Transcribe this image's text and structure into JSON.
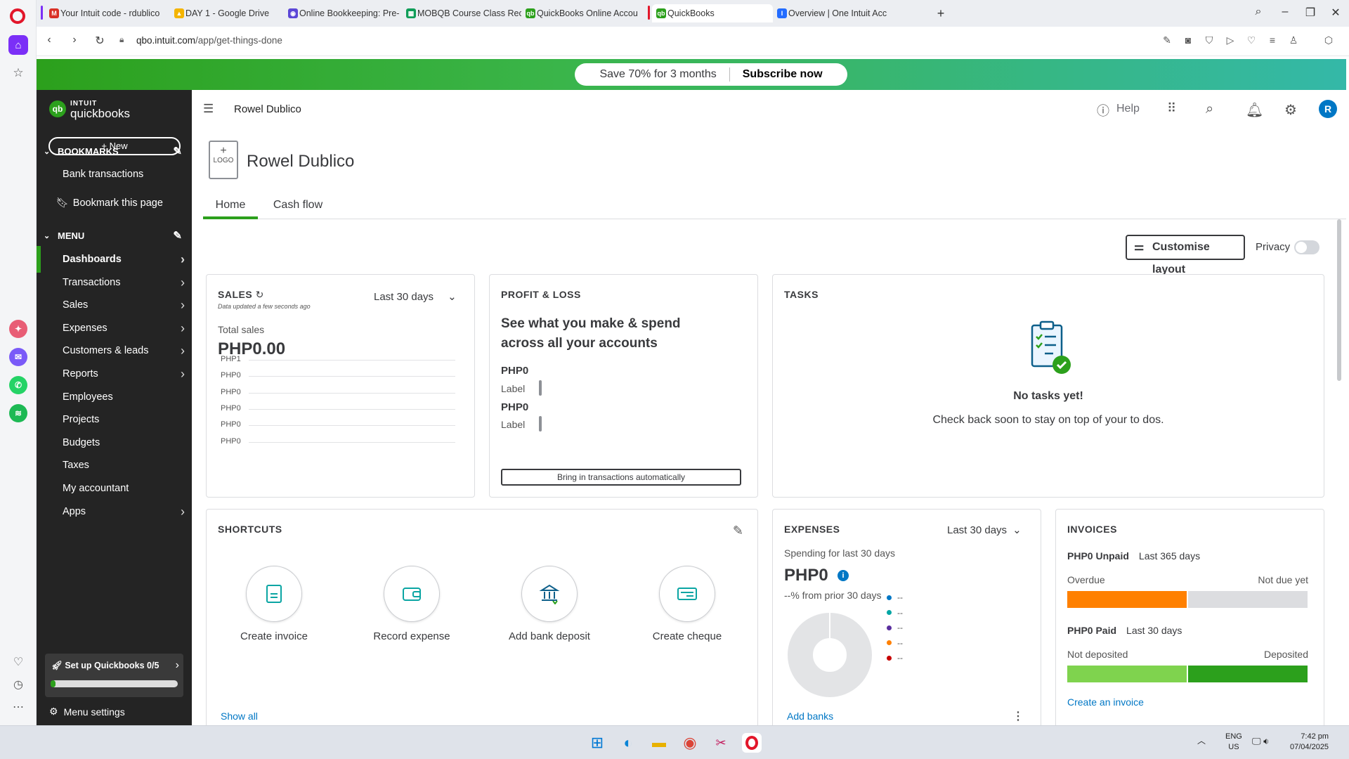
{
  "browser": {
    "tabs": [
      {
        "title": "Your Intuit code - rdublico",
        "fav": "M",
        "color": "#d93025",
        "accent": "#7b2ff7"
      },
      {
        "title": "DAY 1 - Google Drive",
        "fav": "▲",
        "color": "#f4b400",
        "accent": ""
      },
      {
        "title": "Online Bookkeeping: Pre-",
        "fav": "◉",
        "color": "#5b46d6",
        "accent": ""
      },
      {
        "title": "MOBQB Course Class Rec",
        "fav": "▦",
        "color": "#0f9d58",
        "accent": ""
      },
      {
        "title": "QuickBooks Online Accou",
        "fav": "qb",
        "color": "#2ca01c",
        "accent": ""
      },
      {
        "title": "QuickBooks",
        "fav": "qb",
        "color": "#2ca01c",
        "accent": "#e2162a"
      },
      {
        "title": "Overview | One Intuit Acc",
        "fav": "I",
        "color": "#236cff",
        "accent": ""
      }
    ],
    "url_host": "qbo.intuit.com",
    "url_path": "/app/get-things-done"
  },
  "promo": {
    "text": "Save 70% for 3 months",
    "cta": "Subscribe now"
  },
  "nav": {
    "logo_top": "INTUIT",
    "logo_bottom": "quickbooks",
    "new_label": "+ New",
    "bookmarks_header": "BOOKMARKS",
    "bookmarks": [
      "Bank transactions",
      "Bookmark this page"
    ],
    "menu_header": "MENU",
    "items": [
      {
        "label": "Dashboards",
        "arrow": true
      },
      {
        "label": "Transactions",
        "arrow": true
      },
      {
        "label": "Sales",
        "arrow": true
      },
      {
        "label": "Expenses",
        "arrow": true
      },
      {
        "label": "Customers & leads",
        "arrow": true
      },
      {
        "label": "Reports",
        "arrow": true
      },
      {
        "label": "Employees",
        "arrow": false
      },
      {
        "label": "Projects",
        "arrow": false
      },
      {
        "label": "Budgets",
        "arrow": false
      },
      {
        "label": "Taxes",
        "arrow": false
      },
      {
        "label": "My accountant",
        "arrow": false
      },
      {
        "label": "Apps",
        "arrow": true
      }
    ],
    "setup_label": "Set up Quickbooks 0/5",
    "setup_progress": 0.04,
    "menu_settings": "Menu settings"
  },
  "header": {
    "company": "Rowel Dublico",
    "help": "Help",
    "avatar": "R"
  },
  "page": {
    "logo_plus": "+",
    "logo_text": "LOGO",
    "company_name": "Rowel Dublico",
    "tabs": [
      "Home",
      "Cash flow"
    ],
    "customise": "Customise layout",
    "privacy": "Privacy"
  },
  "sales": {
    "title": "SALES",
    "updated": "Data updated a few seconds ago",
    "period": "Last 30 days",
    "total_label": "Total sales",
    "total": "PHP0.00",
    "y_labels": [
      "PHP1",
      "PHP0",
      "PHP0",
      "PHP0",
      "PHP0",
      "PHP0"
    ]
  },
  "profit_loss": {
    "title": "PROFIT & LOSS",
    "headline": "See what you make & spend across all your accounts",
    "rows": [
      {
        "value": "PHP0",
        "label": "Label"
      },
      {
        "value": "PHP0",
        "label": "Label"
      }
    ],
    "button": "Bring in transactions automatically"
  },
  "tasks": {
    "title": "TASKS",
    "empty_title": "No tasks yet!",
    "empty_text": "Check back soon to stay on top of your to dos."
  },
  "shortcuts": {
    "title": "SHORTCUTS",
    "items": [
      "Create invoice",
      "Record expense",
      "Add bank deposit",
      "Create cheque"
    ],
    "show_all": "Show all"
  },
  "expenses": {
    "title": "EXPENSES",
    "period": "Last 30 days",
    "spending_label": "Spending for last 30 days",
    "amount": "PHP0",
    "prior": "--% from prior 30 days",
    "legend": [
      {
        "color": "#0077c5",
        "label": "--"
      },
      {
        "color": "#00a6a4",
        "label": "--"
      },
      {
        "color": "#5a2e9e",
        "label": "--"
      },
      {
        "color": "#ff8000",
        "label": "--"
      },
      {
        "color": "#c70000",
        "label": "--"
      }
    ],
    "add_banks": "Add banks"
  },
  "invoices": {
    "title": "INVOICES",
    "unpaid": "PHP0 Unpaid",
    "unpaid_period": "Last 365 days",
    "overdue": "Overdue",
    "not_due": "Not due yet",
    "paid": "PHP0 Paid",
    "paid_period": "Last 30 days",
    "not_deposited": "Not deposited",
    "deposited": "Deposited",
    "create": "Create an invoice"
  },
  "taskbar": {
    "lang": "ENG",
    "region": "US",
    "time": "7:42 pm",
    "date": "07/04/2025"
  }
}
